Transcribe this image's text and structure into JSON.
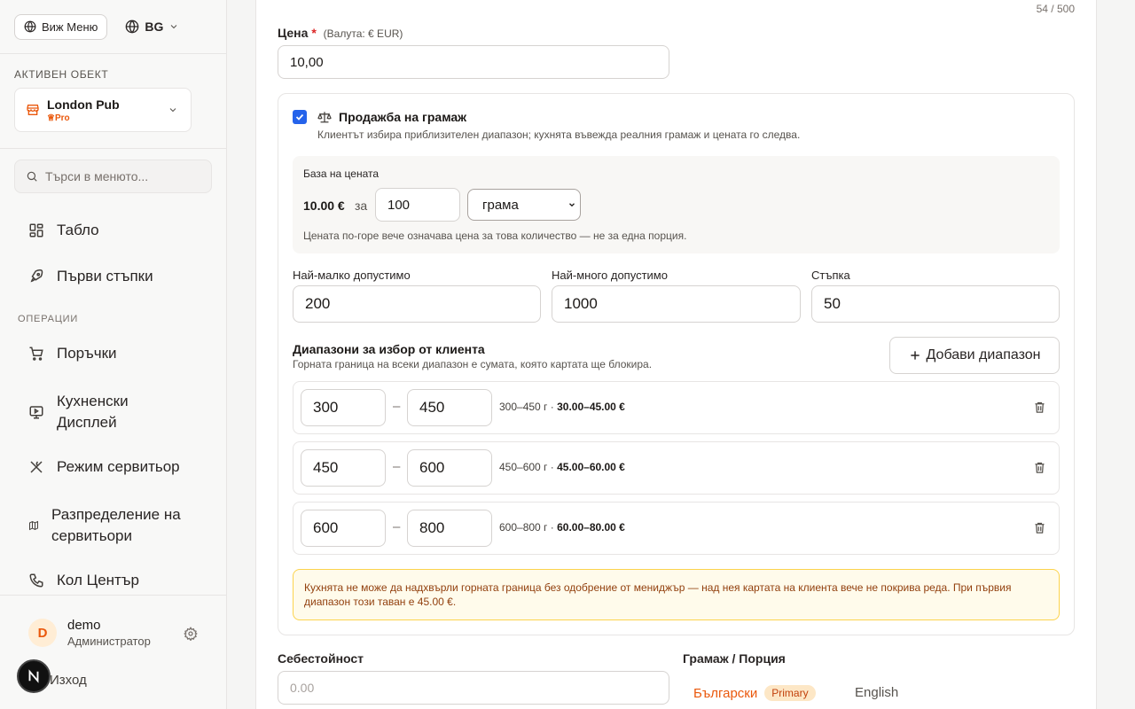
{
  "sidebar": {
    "view_menu_label": "Виж Меню",
    "lang_label": "BG",
    "active_object_label": "Активен обект",
    "active_object_name": "London Pub",
    "active_object_plan": "Pro",
    "search_placeholder": "Търси в менюто...",
    "items": [
      {
        "label": "Табло",
        "icon": "dashboard-icon"
      },
      {
        "label": "Първи стъпки",
        "icon": "rocket-icon"
      }
    ],
    "section_operations": "ОПЕРАЦИИ",
    "ops_items": [
      {
        "label": "Поръчки",
        "icon": "cart-icon"
      },
      {
        "label": "Кухненски Дисплей",
        "icon": "display-icon"
      },
      {
        "label": "Режим сервитьор",
        "icon": "utensils-icon"
      },
      {
        "label": "Разпределение на сервитьори",
        "icon": "map-icon"
      },
      {
        "label": "Кол Център",
        "icon": "phone-icon"
      }
    ],
    "user": {
      "initial": "D",
      "name": "demo",
      "role": "Администратор"
    },
    "logout_label": "Изход",
    "colors": {
      "accent": "#ea580c"
    }
  },
  "form": {
    "description_counter": "54 / 500",
    "price_label": "Цена",
    "price_required": "*",
    "price_currency_hint": "(Валута: € EUR)",
    "price_value": "10,00",
    "weight_sale": {
      "enabled": true,
      "title": "Продажба на грамаж",
      "subtitle": "Клиентът избира приблизителен диапазон; кухнята въвежда реалния грамаж и цената го следва.",
      "price_base_label": "База на цената",
      "price_base_price": "10.00 €",
      "price_base_for": "за",
      "price_base_qty": "100",
      "price_base_unit": "грама",
      "price_base_note": "Цената по-горе вече означава цена за това количество — не за една порция.",
      "min_label": "Най-малко допустимо",
      "min_value": "200",
      "max_label": "Най-много допустимо",
      "max_value": "1000",
      "step_label": "Стъпка",
      "step_value": "50",
      "ranges_title": "Диапазони за избор от клиента",
      "ranges_subtitle": "Горната граница на всеки диапазон е сумата, която картата ще блокира.",
      "add_range_label": "Добави диапазон",
      "ranges": [
        {
          "from": "300",
          "to": "450",
          "summary_range": "300–450 г ·",
          "summary_price": "30.00–45.00 €"
        },
        {
          "from": "450",
          "to": "600",
          "summary_range": "450–600 г ·",
          "summary_price": "45.00–60.00 €"
        },
        {
          "from": "600",
          "to": "800",
          "summary_range": "600–800 г ·",
          "summary_price": "60.00–80.00 €"
        }
      ],
      "warning": "Кухнята не може да надхвърли горната граница без одобрение от мениджър — над нея картата на клиента вече не покрива реда. При първия диапазон този таван е 45.00 €."
    },
    "cost_label": "Себестойност",
    "cost_placeholder": "0.00",
    "grammage_label": "Грамаж / Порция",
    "tab_bg_label": "Български",
    "tab_bg_badge": "Primary",
    "tab_en_label": "English"
  }
}
